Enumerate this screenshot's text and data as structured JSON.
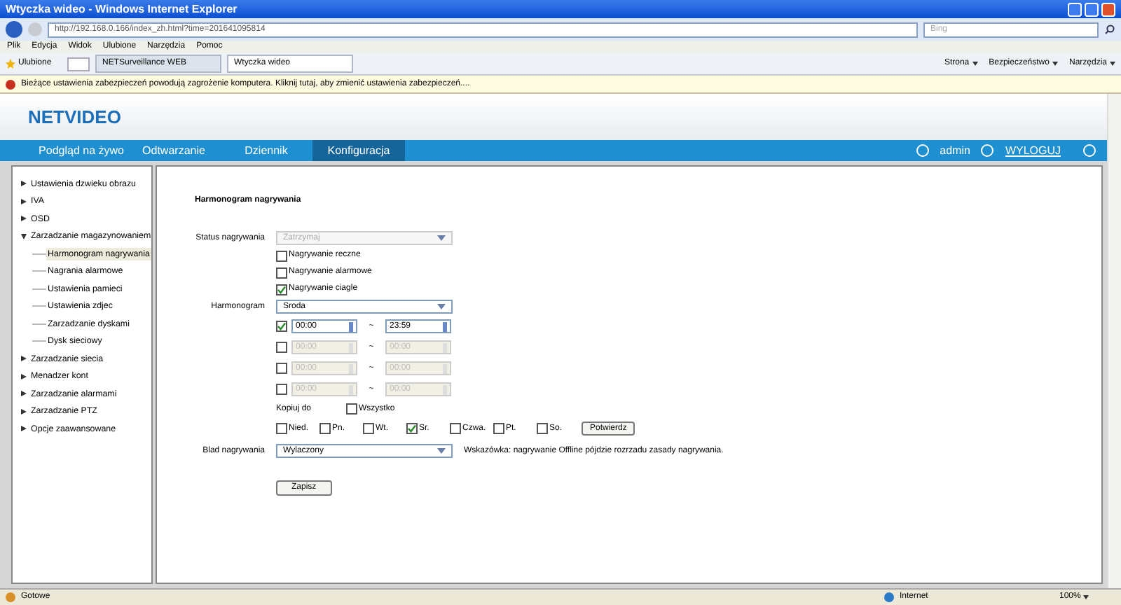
{
  "window": {
    "title": "Wtyczka wideo - Windows Internet Explorer"
  },
  "address": "http://192.168.0.166/index_zh.html?time=201641095814",
  "search": {
    "placeholder": "Bing"
  },
  "menu": [
    "Plik",
    "Edycja",
    "Widok",
    "Ulubione",
    "Narzędzia",
    "Pomoc"
  ],
  "favorites": "Ulubione",
  "tabs": [
    {
      "label": "NETSurveillance WEB",
      "selected": false
    },
    {
      "label": "Wtyczka wideo",
      "selected": true
    }
  ],
  "command_bar": [
    "Strona",
    "Bezpieczeństwo",
    "Narzędzia"
  ],
  "info_bar": "Bieżące ustawienia zabezpieczeń powodują zagrożenie komputera. Kliknij tutaj, aby zmienić ustawienia zabezpieczeń....",
  "logo": "NETVIDEO",
  "nav": [
    {
      "label": "Podgląd na żywo",
      "selected": false
    },
    {
      "label": "Odtwarzanie",
      "selected": false
    },
    {
      "label": "Dziennik",
      "selected": false
    },
    {
      "label": "Konfiguracja",
      "selected": true
    }
  ],
  "user": "admin",
  "logout": "WYLOGUJ",
  "sidebar": [
    {
      "label": "Ustawienia dzwieku obrazu",
      "expanded": false
    },
    {
      "label": "IVA",
      "expanded": false
    },
    {
      "label": "OSD",
      "expanded": false
    },
    {
      "label": "Zarzadzanie magazynowaniem",
      "expanded": true,
      "children": [
        {
          "label": "Harmonogram nagrywania",
          "selected": true
        },
        {
          "label": "Nagrania alarmowe",
          "selected": false
        },
        {
          "label": "Ustawienia pamieci",
          "selected": false
        },
        {
          "label": "Ustawienia zdjec",
          "selected": false
        },
        {
          "label": "Zarzadzanie dyskami",
          "selected": false
        },
        {
          "label": "Dysk sieciowy",
          "selected": false
        }
      ]
    },
    {
      "label": "Zarzadzanie siecia",
      "expanded": false
    },
    {
      "label": "Menadzer kont",
      "expanded": false
    },
    {
      "label": "Zarzadzanie alarmami",
      "expanded": false
    },
    {
      "label": "Zarzadzanie PTZ",
      "expanded": false
    },
    {
      "label": "Opcje zaawansowane",
      "expanded": false
    }
  ],
  "form": {
    "heading": "Harmonogram nagrywania",
    "status": {
      "label": "Status nagrywania",
      "value": "Zatrzymaj",
      "disabled": true
    },
    "modes": [
      {
        "label": "Nagrywanie reczne",
        "checked": false
      },
      {
        "label": "Nagrywanie alarmowe",
        "checked": false
      },
      {
        "label": "Nagrywanie ciagle",
        "checked": true
      }
    ],
    "schedule": {
      "label": "Harmonogram",
      "value": "Sroda"
    },
    "periods": [
      {
        "enabled": true,
        "start": "00:00",
        "sep": "~",
        "end": "23:59"
      },
      {
        "enabled": false,
        "start": "00:00",
        "sep": "~",
        "end": "00:00"
      },
      {
        "enabled": false,
        "start": "00:00",
        "sep": "~",
        "end": "00:00"
      },
      {
        "enabled": false,
        "start": "00:00",
        "sep": "~",
        "end": "00:00"
      }
    ],
    "copy_label": "Kopiuj do",
    "all": {
      "label": "Wszystko",
      "checked": false
    },
    "days": [
      {
        "label": "Nied.",
        "checked": false
      },
      {
        "label": "Pn.",
        "checked": false
      },
      {
        "label": "Wt.",
        "checked": false
      },
      {
        "label": "Sr.",
        "checked": true
      },
      {
        "label": "Czwa.",
        "checked": false
      },
      {
        "label": "Pt.",
        "checked": false
      },
      {
        "label": "So.",
        "checked": false
      }
    ],
    "confirm": "Potwierdz",
    "error": {
      "label": "Blad nagrywania",
      "value": "Wylaczony"
    },
    "hint": "Wskazówka: nagrywanie Offline pójdzie rozrzadu zasady nagrywania.",
    "save": "Zapisz"
  },
  "status_bar": {
    "text": "Gotowe",
    "zone": "Internet",
    "zoom": "100%"
  }
}
